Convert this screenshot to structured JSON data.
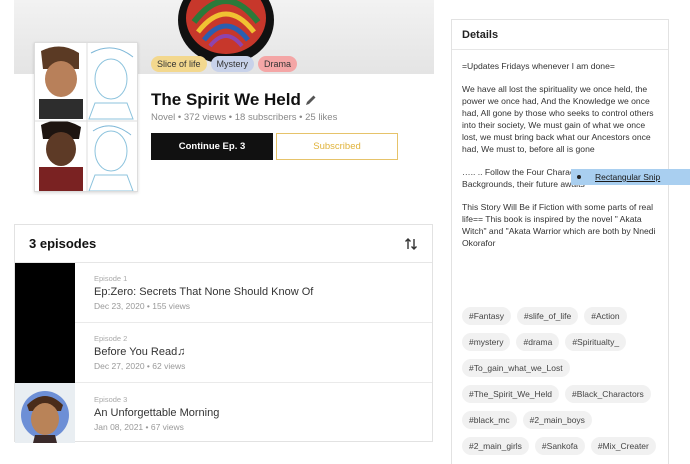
{
  "series": {
    "genres": [
      "Slice of life",
      "Mystery",
      "Drama"
    ],
    "title": "The Spirit We Held",
    "meta": "Novel • 372 views • 18 subscribers • 25 likes",
    "continue_label": "Continue Ep. 3",
    "subscribe_label": "Subscribed"
  },
  "episodes": {
    "count_label": "3 episodes",
    "items": [
      {
        "number": "Episode 1",
        "title": "Ep:Zero: Secrets That None Should Know Of",
        "sub": "Dec 23, 2020 • 155 views"
      },
      {
        "number": "Episode 2",
        "title": "Before You Read♫",
        "sub": "Dec 27, 2020 • 62 views"
      },
      {
        "number": "Episode 3",
        "title": "An Unforgettable Morning",
        "sub": "Jan 08, 2021 • 67 views"
      }
    ]
  },
  "details": {
    "heading": "Details",
    "paragraphs": [
      "=Updates Fridays whenever I am done=",
      "We have all lost the spirituality we once held, the power we once had, And the Knowledge we once had, All gone by those who seeks to control others into their society, We must gain of what we once lost, we must bring back what our Ancestors once had, We must to, before all is gone",
      "….. .. Follow the Four Characters from different Backgrounds, their future awaits",
      "This Story Will Be if Fiction with some parts of real life== This book is inspired by the novel \" Akata Witch\" and \"Akata Warrior which are both by Nnedi Okorafor"
    ],
    "tags": [
      "#Fantasy",
      "#slife_of_life",
      "#Action",
      "#mystery",
      "#drama",
      "#Spiritualty_",
      "#To_gain_what_we_Lost",
      "#The_Spirit_We_Held",
      "#Black_Charactors",
      "#black_mc",
      "#2_main_boys",
      "#2_main_girls",
      "#Sankofa",
      "#Mix_Creater"
    ]
  },
  "overlay": {
    "snip_label": "Rectangular Snip"
  }
}
